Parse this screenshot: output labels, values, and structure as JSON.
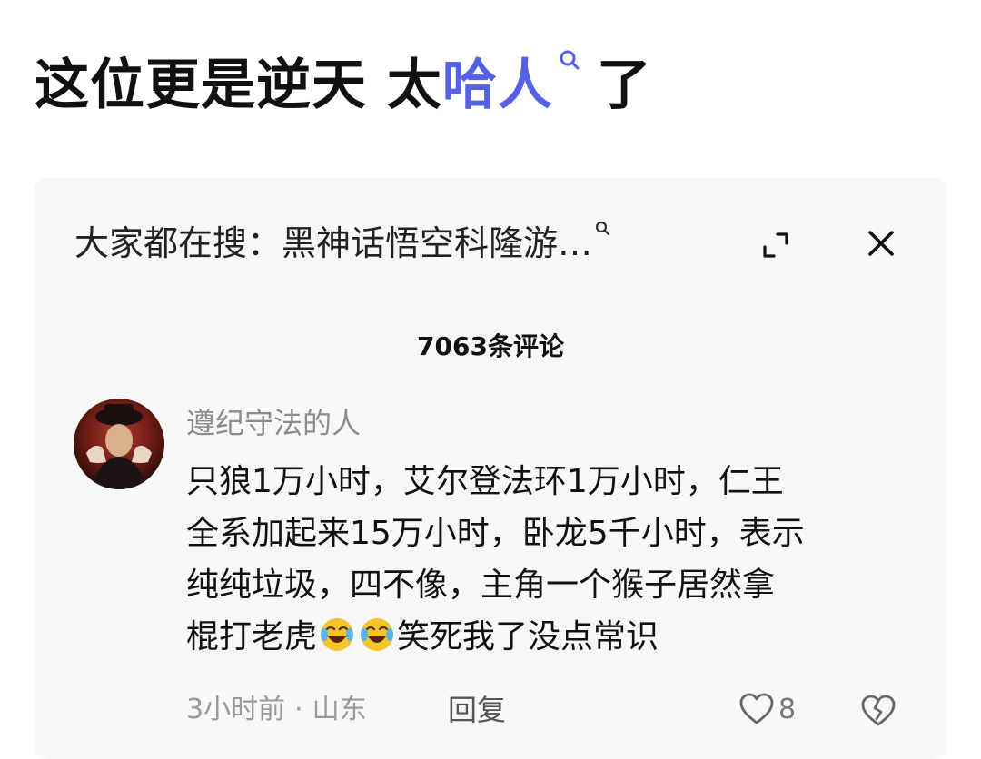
{
  "post": {
    "title_before": "这位更是逆天 太",
    "title_highlight": "哈人",
    "title_after": "了",
    "highlight_color": "#5560e6",
    "highlight_icon": "search-icon"
  },
  "card": {
    "search_prefix": "大家都在搜：",
    "search_query": "黑神话悟空科隆游…",
    "search_icon": "search-icon",
    "expand_icon": "expand-icon",
    "close_icon": "close-icon",
    "comment_count": "7063条评论"
  },
  "comment": {
    "username": "遵纪守法的人",
    "text_lines": [
      "只狼1万小时，艾尔登法环1万小时，仁王",
      "全系加起来15万小时，卧龙5千小时，表示",
      "纯纯垃圾，四不像，主角一个猴子居然拿",
      "棍打老虎"
    ],
    "text_tail": "笑死我了没点常识",
    "emojis": [
      "laughing-crying-emoji",
      "laughing-crying-emoji"
    ],
    "time": "3小时前",
    "separator": "·",
    "location": "山东",
    "reply_label": "回复",
    "like_count": "8",
    "like_icon": "heart-icon",
    "dislike_icon": "broken-heart-icon"
  }
}
